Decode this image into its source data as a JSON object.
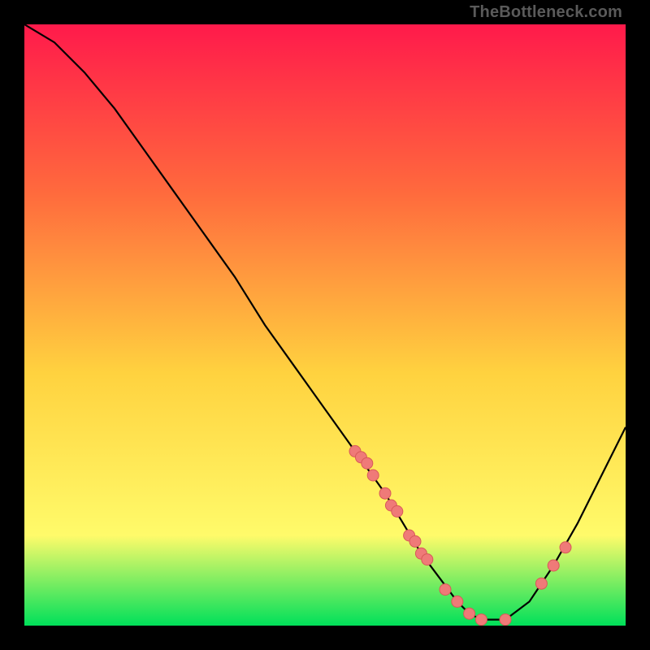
{
  "attribution": "TheBottleneck.com",
  "colors": {
    "frame": "#000000",
    "gradient_top": "#ff1a4b",
    "gradient_mid1": "#ff6a3d",
    "gradient_mid2": "#ffd23f",
    "gradient_mid3": "#fffb6a",
    "gradient_bottom": "#00e05a",
    "curve": "#000000",
    "dot_fill": "#ef7a78",
    "dot_stroke": "#d85a58"
  },
  "chart_data": {
    "type": "line",
    "title": "",
    "xlabel": "",
    "ylabel": "",
    "xlim": [
      0,
      100
    ],
    "ylim": [
      0,
      100
    ],
    "grid": false,
    "legend": false,
    "series": [
      {
        "name": "bottleneck-curve",
        "x": [
          0,
          5,
          10,
          15,
          20,
          25,
          30,
          35,
          40,
          45,
          50,
          55,
          60,
          63,
          66,
          69,
          72,
          74,
          76,
          80,
          84,
          88,
          92,
          96,
          100
        ],
        "y": [
          100,
          97,
          92,
          86,
          79,
          72,
          65,
          58,
          50,
          43,
          36,
          29,
          22,
          17,
          12,
          8,
          4,
          2,
          1,
          1,
          4,
          10,
          17,
          25,
          33
        ]
      }
    ],
    "highlight_points": {
      "name": "dots",
      "x": [
        55,
        56,
        57,
        58,
        60,
        61,
        62,
        64,
        65,
        66,
        67,
        70,
        72,
        74,
        76,
        80,
        86,
        88,
        90
      ],
      "y": [
        29,
        28,
        27,
        25,
        22,
        20,
        19,
        15,
        14,
        12,
        11,
        6,
        4,
        2,
        1,
        1,
        7,
        10,
        13
      ]
    }
  }
}
